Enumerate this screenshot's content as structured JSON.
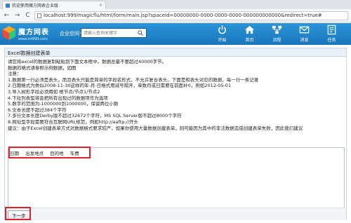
{
  "browser": {
    "tab_title": "欢迎使用魔方网表企业版",
    "tab_close": "×",
    "back": "←",
    "forward": "→",
    "reload": "C",
    "url": "localhost:999/magicflu/html/form/main.jsp?spaceId=00000000-0000-0000-0000-000000000000&redirect=true#"
  },
  "header": {
    "brand_name": "魔方网表",
    "brand_url": "www.mf999.com",
    "space_switch": "企业空间",
    "search_placeholder": "请输入查询关键字",
    "nav": [
      {
        "label": "开始",
        "icon": "power-icon"
      },
      {
        "label": "首页",
        "icon": "home-icon"
      },
      {
        "label": "流程",
        "icon": "workflow-icon"
      },
      {
        "label": "消息",
        "icon": "mail-icon"
      },
      {
        "label": "任务",
        "icon": "task-icon"
      }
    ]
  },
  "form": {
    "title": "Excel数据创建表单",
    "instructions": [
      "请您将excel的数据复制粘贴到下面文本框中。数据总量不要超过40000字节。",
      "数据的格式请参照示例数据，如图",
      "注意：",
      "1.数据第一行必须是表头，而且表头只能是简单的字段名形式，不允许复合表头。下面是和表头对应的数据，每一行一条记录",
      "2.日期格式为类似2008-11-30这样的年-月-日格式用减号隔开，单数月或日需要在前面补0，例如2012-05-01",
      "3.导入树形字段必须用如 根节点/节点1/节点2",
      "4.下拉列表型将会把所有出现过的数据项作为选项",
      "5.数字的范围为-1000000到1000000，保留两位小数",
      "6.文本长度不超过384个字符",
      "7.多行文本长度Derby版不超过32672个字符，MS SQL Server版不超过8000个字符",
      "8.网址型字段需要符合互联网URL规范，例如http://aaftp://开头",
      "建议：由于Excel创建表单方式对数据格式要求较严，如果你使用大量数据创建表单，则可能因为其中的非法数据造成创建表单失败，因此我们建议"
    ],
    "columns": [
      "日期",
      "出发地点",
      "目的地",
      "车费"
    ],
    "next_button": "下一步"
  },
  "colors": {
    "header_blue": "#1f86c9",
    "highlight_red": "#e0202a"
  }
}
